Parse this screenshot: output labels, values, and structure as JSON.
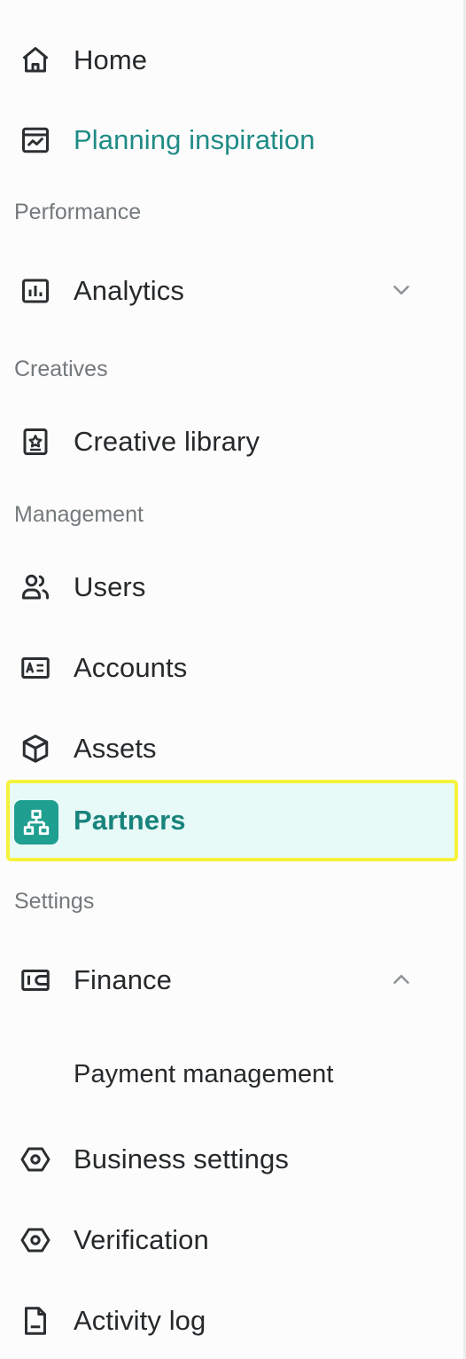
{
  "sidebar": {
    "items": [
      {
        "label": "Home",
        "icon": "home-icon"
      },
      {
        "label": "Planning inspiration",
        "icon": "planning-inspiration-icon",
        "color": "#1f8b85"
      },
      {
        "section": "Performance"
      },
      {
        "label": "Analytics",
        "icon": "analytics-icon",
        "expandable": true,
        "expanded": false
      },
      {
        "section": "Creatives"
      },
      {
        "label": "Creative library",
        "icon": "creative-library-icon"
      },
      {
        "section": "Management"
      },
      {
        "label": "Users",
        "icon": "users-icon"
      },
      {
        "label": "Accounts",
        "icon": "accounts-icon"
      },
      {
        "label": "Assets",
        "icon": "assets-icon"
      },
      {
        "label": "Partners",
        "icon": "partners-icon",
        "active": true
      },
      {
        "section": "Settings"
      },
      {
        "label": "Finance",
        "icon": "finance-icon",
        "expandable": true,
        "expanded": true
      },
      {
        "label": "Payment management",
        "subitem": true
      },
      {
        "label": "Business settings",
        "icon": "business-settings-icon"
      },
      {
        "label": "Verification",
        "icon": "verification-icon"
      },
      {
        "label": "Activity log",
        "icon": "activity-log-icon"
      }
    ]
  },
  "colors": {
    "accent": "#1f8b85",
    "active_background": "#e8faf8",
    "active_icon_background": "#1e9f90",
    "highlight_outline": "#f5f23c",
    "section_text": "#74797c"
  }
}
